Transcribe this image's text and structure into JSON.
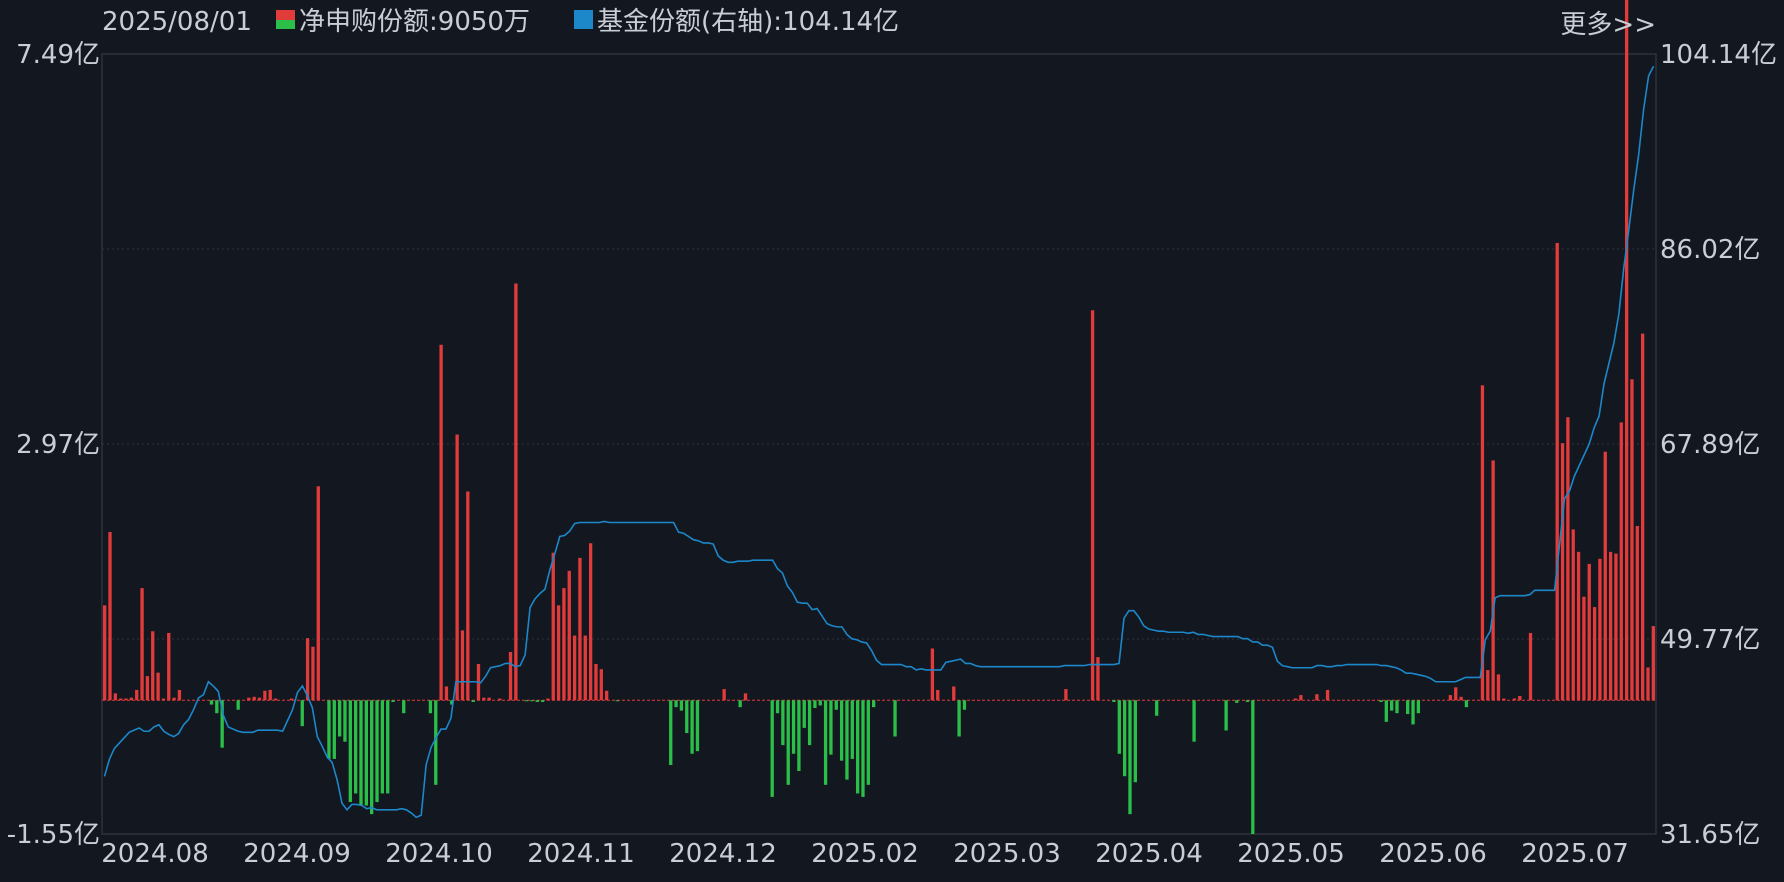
{
  "header": {
    "date": "2025/08/01",
    "more_label": "更多>>"
  },
  "legend": [
    {
      "name": "净申购份额",
      "value": "9050万",
      "swatch": [
        "#e23b3b",
        "#2bbf4a"
      ]
    },
    {
      "name": "基金份额(右轴)",
      "value": "104.14亿",
      "swatch": [
        "#1c87c9"
      ]
    }
  ],
  "chart_data": {
    "type": "bar+line",
    "left_axis": {
      "ticks": [
        "7.49亿",
        "2.97亿",
        "-1.55亿"
      ],
      "min": -1.55,
      "max": 7.49,
      "unit": "亿"
    },
    "right_axis": {
      "ticks": [
        "104.14亿",
        "86.02亿",
        "67.89亿",
        "49.77亿",
        "31.65亿"
      ],
      "min": 31.65,
      "max": 104.14,
      "unit": "亿"
    },
    "x_ticks": [
      "2024.08",
      "2024.09",
      "2024.10",
      "2024.11",
      "2024.12",
      "2025.02",
      "2025.03",
      "2025.04",
      "2025.05",
      "2025.06",
      "2025.07"
    ],
    "grid": true,
    "colors": {
      "positive": "#e23b3b",
      "negative": "#2bbf4a",
      "line": "#1c87c9"
    },
    "series": [
      {
        "name": "净申购份额",
        "type": "bar",
        "values": [
          1.1,
          1.95,
          0.08,
          0.02,
          0.02,
          0.03,
          0.12,
          1.3,
          0.28,
          0.8,
          0.32,
          0.02,
          0.78,
          0.03,
          0.12,
          0.0,
          0.0,
          0.0,
          0.0,
          0.0,
          -0.05,
          -0.15,
          -0.55,
          0.0,
          0.0,
          -0.11,
          0.0,
          0.03,
          0.04,
          0.03,
          0.11,
          0.12,
          0.02,
          0.0,
          0.0,
          0.02,
          0.0,
          -0.3,
          0.72,
          0.62,
          2.48,
          -0.0,
          -0.68,
          -0.68,
          -0.42,
          -0.48,
          -1.18,
          -1.08,
          -1.22,
          -1.22,
          -1.32,
          -1.18,
          -1.08,
          -1.08,
          -0.02,
          0.0,
          -0.15,
          0.0,
          0.0,
          0.0,
          0.0,
          -0.15,
          -0.98,
          4.12,
          0.16,
          -0.05,
          3.08,
          0.81,
          2.42,
          -0.02,
          0.42,
          0.03,
          0.03,
          0.0,
          0.02,
          0.0,
          0.56,
          4.83,
          0.0,
          -0.01,
          -0.01,
          -0.02,
          -0.02,
          0.02,
          1.71,
          1.1,
          1.3,
          1.5,
          0.75,
          1.65,
          0.75,
          1.82,
          0.42,
          0.36,
          0.11,
          -0.0,
          -0.01,
          0.0,
          -0.0,
          0.0,
          -0.0,
          0.0,
          0.0,
          0.0,
          0.0,
          0.0,
          -0.75,
          -0.08,
          -0.12,
          -0.38,
          -0.62,
          -0.59,
          0.0,
          0.0,
          0.0,
          0.0,
          0.13,
          0.0,
          0.0,
          -0.08,
          0.08,
          0.0,
          0.0,
          0.0,
          0.0,
          -1.12,
          -0.15,
          -0.52,
          -0.98,
          -0.62,
          -0.82,
          -0.32,
          -0.52,
          -0.09,
          -0.06,
          -0.98,
          -0.63,
          -0.11,
          -0.7,
          -0.92,
          -0.68,
          -1.08,
          -1.12,
          -0.98,
          -0.08,
          0.0,
          0.0,
          0.0,
          -0.42,
          0.0,
          0.0,
          0.0,
          0.0,
          0.0,
          0.0,
          0.6,
          0.12,
          0.0,
          0.0,
          0.16,
          -0.42,
          -0.11,
          0.0,
          0.0,
          0.0,
          0.0,
          0.0,
          0.0,
          0.0,
          0.0,
          0.0,
          0.0,
          0.0,
          0.0,
          0.0,
          0.0,
          0.0,
          0.0,
          0.0,
          0.0,
          0.13,
          0.0,
          0.0,
          0.0,
          0.0,
          4.52,
          0.5,
          0.0,
          0.0,
          -0.02,
          -0.62,
          -0.88,
          -1.32,
          -0.95,
          0.0,
          0.0,
          0.0,
          -0.18,
          0.0,
          0.0,
          0.0,
          0.0,
          0.0,
          0.0,
          -0.48,
          0.0,
          0.0,
          0.0,
          0.0,
          0.0,
          -0.35,
          0.0,
          -0.03,
          0.0,
          -0.02,
          -1.55,
          0.0,
          0.0,
          0.0,
          0.0,
          0.0,
          0.0,
          0.0,
          0.02,
          0.06,
          0.0,
          0.0,
          0.07,
          0.0,
          0.12,
          0.0,
          0.0,
          0.0,
          0.0,
          0.0,
          0.0,
          0.0,
          0.0,
          0.0,
          -0.02,
          -0.25,
          -0.12,
          -0.15,
          0.0,
          -0.16,
          -0.28,
          -0.15,
          -0.0,
          0.0,
          0.0,
          0.0,
          0.0,
          0.06,
          0.15,
          0.04,
          -0.08,
          0.0,
          0.0,
          3.65,
          0.35,
          2.78,
          0.3,
          0.02,
          0.0,
          0.02,
          0.05,
          0.0,
          0.78,
          0.0,
          0.0,
          0.0,
          0.0,
          5.3,
          2.98,
          3.28,
          1.98,
          1.72,
          1.2,
          1.58,
          1.08,
          1.64,
          2.88,
          1.72,
          1.7,
          3.22,
          8.8,
          3.72,
          2.02,
          4.25,
          0.38,
          0.86
        ]
      },
      {
        "name": "基金份额(右轴)",
        "type": "line",
        "values": [
          37.0,
          38.6,
          39.6,
          40.1,
          40.6,
          41.1,
          41.3,
          41.5,
          41.2,
          41.2,
          41.6,
          41.8,
          41.2,
          40.9,
          40.7,
          41.0,
          41.8,
          42.3,
          43.2,
          44.3,
          44.6,
          45.8,
          45.4,
          44.9,
          42.7,
          41.6,
          41.4,
          41.2,
          41.1,
          41.1,
          41.1,
          41.3,
          41.3,
          41.3,
          41.3,
          41.3,
          41.2,
          42.2,
          43.2,
          44.8,
          45.4,
          44.5,
          43.4,
          40.7,
          39.8,
          38.8,
          38.3,
          36.7,
          34.5,
          33.9,
          34.4,
          34.4,
          34.3,
          34.0,
          34.1,
          33.9,
          33.9,
          33.9,
          33.9,
          33.9,
          34.0,
          33.9,
          33.6,
          33.2,
          33.4,
          38.1,
          39.7,
          40.6,
          41.4,
          41.4,
          42.4,
          45.8,
          45.8,
          45.8,
          45.8,
          45.8,
          45.7,
          46.3,
          47.1,
          47.2,
          47.3,
          47.5,
          47.5,
          47.2,
          47.3,
          48.3,
          52.7,
          53.5,
          54.0,
          54.4,
          56.2,
          57.7,
          59.3,
          59.4,
          59.8,
          60.5,
          60.6,
          60.6,
          60.6,
          60.6,
          60.6,
          60.7,
          60.6,
          60.6,
          60.6,
          60.6,
          60.6,
          60.6,
          60.6,
          60.6,
          60.6,
          60.6,
          60.6,
          60.6,
          60.6,
          60.6,
          59.7,
          59.6,
          59.3,
          59.0,
          58.9,
          58.7,
          58.7,
          58.6,
          57.5,
          57.1,
          56.9,
          56.9,
          57.0,
          57.0,
          57.0,
          57.1,
          57.1,
          57.1,
          57.1,
          57.1,
          56.3,
          55.9,
          54.7,
          54.1,
          53.2,
          53.1,
          53.1,
          52.5,
          52.6,
          51.9,
          51.2,
          51.0,
          50.9,
          50.9,
          50.2,
          49.8,
          49.7,
          49.5,
          49.4,
          48.7,
          47.8,
          47.4,
          47.4,
          47.4,
          47.4,
          47.4,
          47.2,
          47.2,
          46.9,
          47.0,
          46.9,
          46.9,
          46.9,
          46.9,
          47.6,
          47.7,
          47.8,
          47.9,
          47.5,
          47.5,
          47.3,
          47.2,
          47.2,
          47.2,
          47.2,
          47.2,
          47.2,
          47.2,
          47.2,
          47.2,
          47.2,
          47.2,
          47.2,
          47.2,
          47.2,
          47.2,
          47.2,
          47.2,
          47.3,
          47.3,
          47.3,
          47.3,
          47.3,
          47.4,
          47.4,
          47.4,
          47.4,
          47.4,
          47.4,
          47.5,
          51.7,
          52.4,
          52.4,
          51.8,
          51.0,
          50.7,
          50.6,
          50.5,
          50.5,
          50.4,
          50.4,
          50.4,
          50.4,
          50.3,
          50.4,
          50.2,
          50.2,
          50.1,
          50.0,
          50.0,
          50.0,
          50.0,
          50.0,
          50.0,
          49.8,
          49.8,
          49.5,
          49.5,
          49.2,
          49.2,
          49.0,
          47.7,
          47.3,
          47.2,
          47.1,
          47.1,
          47.1,
          47.1,
          47.1,
          47.3,
          47.3,
          47.2,
          47.2,
          47.3,
          47.3,
          47.4,
          47.4,
          47.4,
          47.4,
          47.4,
          47.4,
          47.4,
          47.3,
          47.3,
          47.2,
          47.1,
          46.9,
          46.6,
          46.6,
          46.5,
          46.4,
          46.3,
          46.1,
          45.8,
          45.8,
          45.8,
          45.8,
          45.8,
          46.0,
          46.2,
          46.2,
          46.2,
          46.2,
          49.7,
          50.5,
          53.6,
          53.8,
          53.8,
          53.8,
          53.8,
          53.8,
          53.8,
          53.9,
          54.3,
          54.3,
          54.3,
          54.3,
          54.3,
          58.5,
          62.8,
          63.5,
          64.9,
          65.9,
          66.9,
          67.9,
          69.4,
          70.5,
          73.5,
          75.4,
          77.3,
          80.0,
          84.3,
          87.8,
          91.5,
          94.8,
          99.0,
          102.1,
          103.0
        ]
      }
    ]
  }
}
